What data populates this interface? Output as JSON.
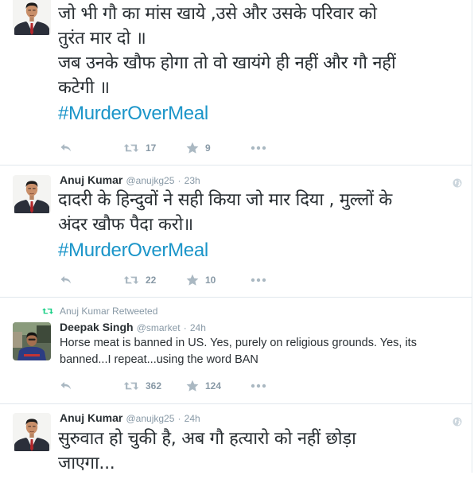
{
  "tweets": [
    {
      "lines": [
        "जो भी गौ का मांस खाये ,उसे  और उसके परिवार को",
        "तुरंत मार दो ॥",
        "जब उनके खौफ होगा तो वो खायंगे ही नहीं और गौ नहीं",
        "कटेगी ॥"
      ],
      "hashtag": "#MurderOverMeal",
      "retweets": "17",
      "likes": "9"
    },
    {
      "fullname": "Anuj Kumar",
      "username": "@anujkg25",
      "dot": "·",
      "time": "23h",
      "lines": [
        "दादरी के हिन्दुवों ने सही किया जो मार दिया , मुल्लों के",
        "अंदर खौफ पैदा करो॥"
      ],
      "hashtag": "#MurderOverMeal",
      "retweets": "22",
      "likes": "10"
    },
    {
      "context": "Anuj Kumar Retweeted",
      "fullname": "Deepak Singh",
      "username": "@smarket",
      "dot": "·",
      "time": "24h",
      "lines": [
        "Horse meat is banned in US. Yes, purely on religious grounds. Yes, its",
        "banned...I repeat...using the word BAN"
      ],
      "retweets": "362",
      "likes": "124"
    },
    {
      "fullname": "Anuj Kumar",
      "username": "@anujkg25",
      "dot": "·",
      "time": "24h",
      "lines": [
        "सुरुवात हो चुकी है, अब गौ हत्यारो को नहीं छोड़ा",
        "जाएगा..."
      ]
    }
  ],
  "icons": {
    "reply": "reply-icon",
    "retweet": "retweet-icon",
    "like": "star-icon",
    "more": "more-icon",
    "globe": "globe-icon"
  },
  "colors": {
    "hashtag": "#1b95c9",
    "meta": "#8899a6",
    "action_icon": "#aab8c2",
    "retweet_context_icon": "#19cf86",
    "divider": "#e1e8ed"
  }
}
